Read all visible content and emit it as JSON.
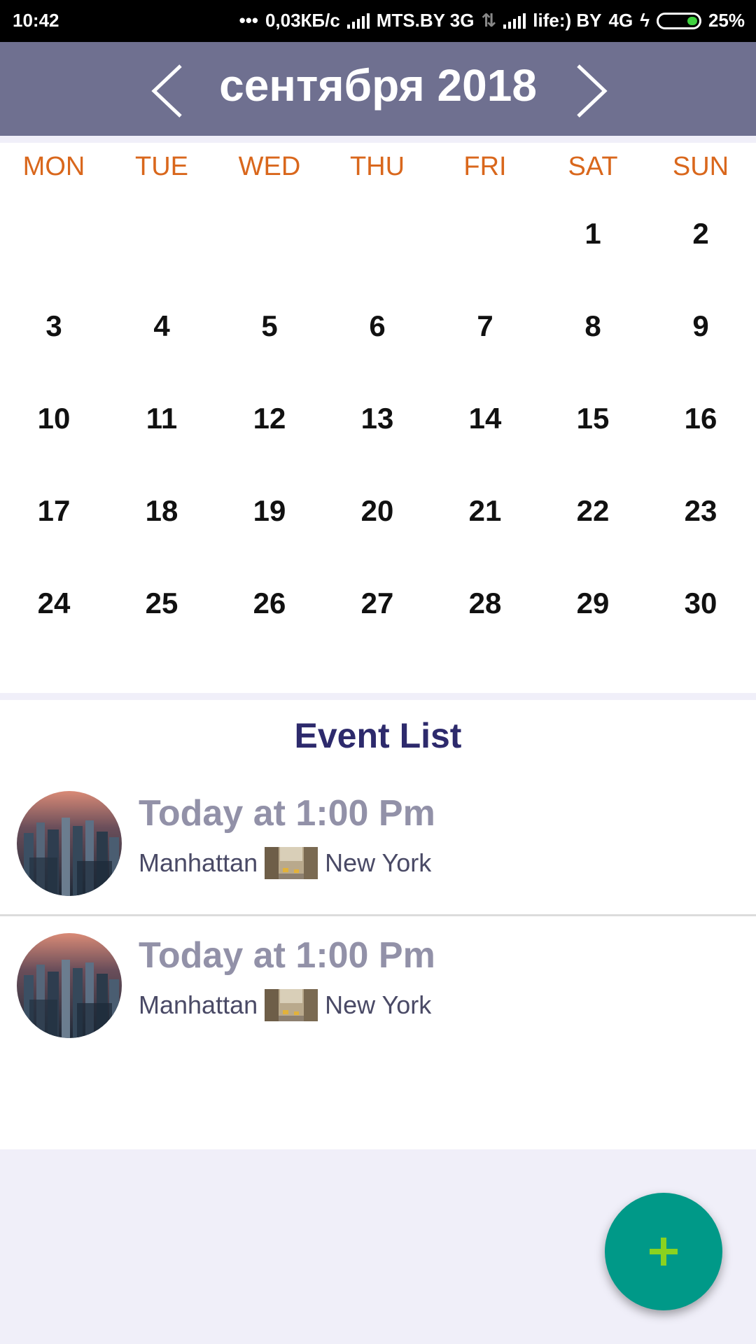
{
  "status_bar": {
    "time": "10:42",
    "dots": "•••",
    "speed": "0,03КБ/с",
    "carrier1": "MTS.BY 3G",
    "carrier2": "life:) BY",
    "network2": "4G",
    "battery": "25%"
  },
  "header": {
    "month_title": "сентября 2018"
  },
  "calendar": {
    "weekdays": [
      "MON",
      "TUE",
      "WED",
      "THU",
      "FRI",
      "SAT",
      "SUN"
    ],
    "weeks": [
      [
        "",
        "",
        "",
        "",
        "",
        "1",
        "2"
      ],
      [
        "3",
        "4",
        "5",
        "6",
        "7",
        "8",
        "9"
      ],
      [
        "10",
        "11",
        "12",
        "13",
        "14",
        "15",
        "16"
      ],
      [
        "17",
        "18",
        "19",
        "20",
        "21",
        "22",
        "23"
      ],
      [
        "24",
        "25",
        "26",
        "27",
        "28",
        "29",
        "30"
      ]
    ]
  },
  "events": {
    "title": "Event List",
    "items": [
      {
        "time": "Today at 1:00 Pm",
        "location": "Manhattan",
        "city": "New York"
      },
      {
        "time": "Today at 1:00 Pm",
        "location": "Manhattan",
        "city": "New York"
      }
    ]
  },
  "fab": {
    "icon": "plus-icon"
  },
  "colors": {
    "header_bg": "#6f7090",
    "weekday": "#d9671c",
    "event_title": "#2d2a6c",
    "event_time": "#9291a8",
    "fab": "#009988",
    "fab_plus": "#8bd21f"
  }
}
